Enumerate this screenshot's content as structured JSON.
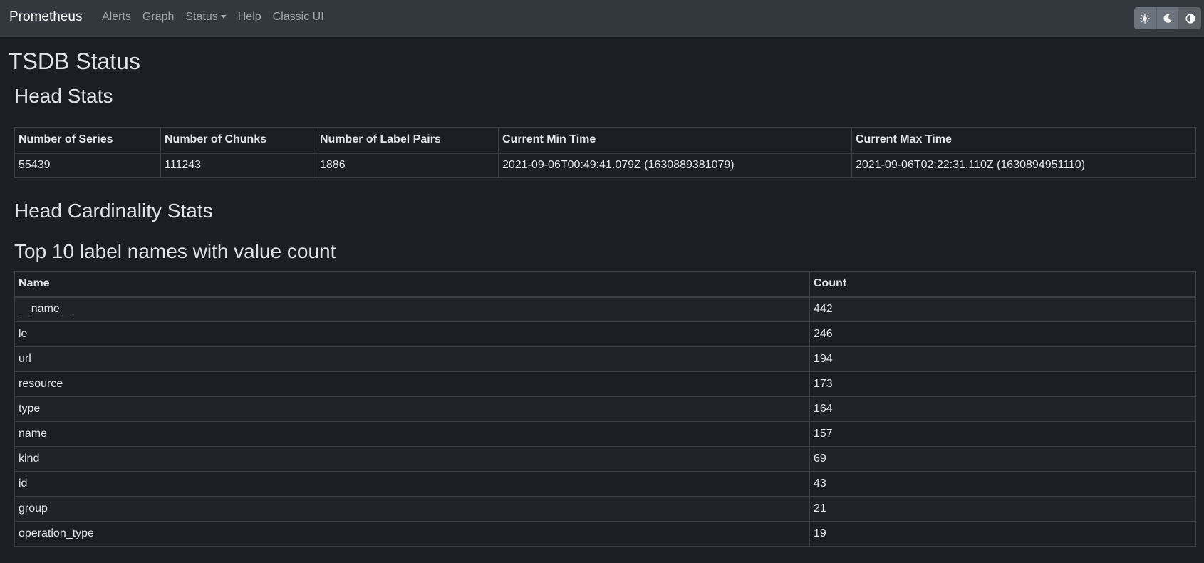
{
  "navbar": {
    "brand": "Prometheus",
    "links": [
      "Alerts",
      "Graph",
      "Status",
      "Help",
      "Classic UI"
    ],
    "theme_buttons": [
      "light-theme",
      "dark-theme",
      "browser-theme"
    ]
  },
  "page": {
    "title": "TSDB Status"
  },
  "head_stats": {
    "heading": "Head Stats",
    "columns": [
      "Number of Series",
      "Number of Chunks",
      "Number of Label Pairs",
      "Current Min Time",
      "Current Max Time"
    ],
    "row": [
      "55439",
      "111243",
      "1886",
      "2021-09-06T00:49:41.079Z (1630889381079)",
      "2021-09-06T02:22:31.110Z (1630894951110)"
    ]
  },
  "cardinality": {
    "heading": "Head Cardinality Stats",
    "subheading": "Top 10 label names with value count",
    "columns": [
      "Name",
      "Count"
    ],
    "rows": [
      {
        "name": "__name__",
        "count": "442"
      },
      {
        "name": "le",
        "count": "246"
      },
      {
        "name": "url",
        "count": "194"
      },
      {
        "name": "resource",
        "count": "173"
      },
      {
        "name": "type",
        "count": "164"
      },
      {
        "name": "name",
        "count": "157"
      },
      {
        "name": "kind",
        "count": "69"
      },
      {
        "name": "id",
        "count": "43"
      },
      {
        "name": "group",
        "count": "21"
      },
      {
        "name": "operation_type",
        "count": "19"
      }
    ]
  },
  "colors": {
    "background": "#1b1e22",
    "navbar": "#33373e",
    "border": "#3b4047",
    "toggle": "#6c757d"
  }
}
